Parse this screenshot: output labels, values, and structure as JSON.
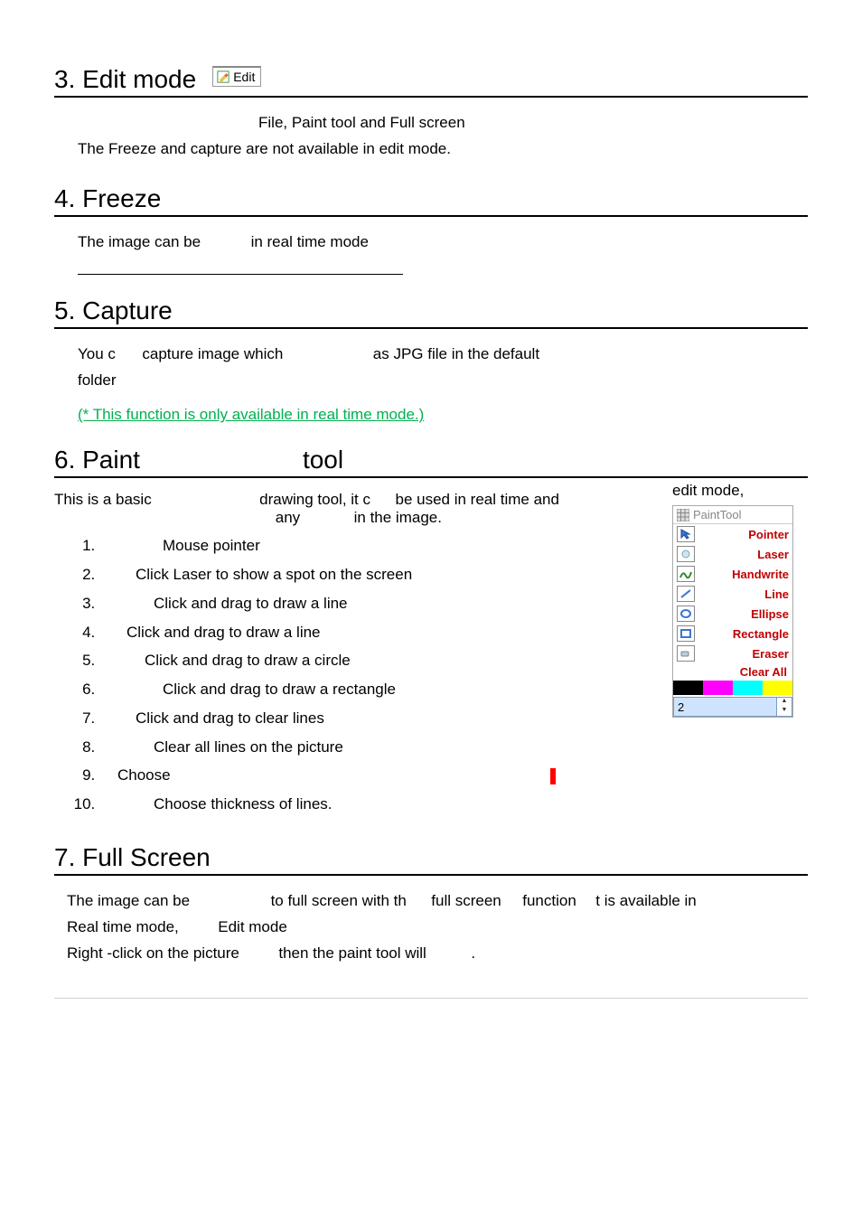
{
  "s3": {
    "heading": "3. Edit mode",
    "badge": "Edit",
    "line1": "File, Paint tool and Full screen",
    "line2": "The Freeze and capture are not available in edit mode."
  },
  "s4": {
    "heading": "4. Freeze",
    "line1a": "The image can be",
    "line1b": "in real time mode"
  },
  "s5": {
    "heading": "5. Capture",
    "l1a": "You c",
    "l1b": "capture image   which",
    "l1c": "as JPG file   in the default",
    "l2": "folder",
    "note": "(* This function is only available in real time mode.)"
  },
  "s6": {
    "heading_a": "6. Paint",
    "heading_b": "tool",
    "intro1a": "This is a basic",
    "intro1b": "drawing tool, it c",
    "intro1c": "be used in real time and",
    "intro2a": "any",
    "intro2b": "in the image.",
    "right_label": "edit mode,",
    "items": [
      "Mouse pointer",
      "Click  Laser  to show a spot on the screen",
      "Click and drag to draw a line",
      "Click and drag to draw a line",
      "Click and drag to draw a circle",
      "Click and drag to draw a rectangle",
      "Click and drag to clear lines",
      "Clear all lines on the picture",
      "Choose",
      "Choose thickness of lines."
    ],
    "item_indent": [
      70,
      40,
      60,
      30,
      50,
      70,
      40,
      60,
      20,
      60
    ]
  },
  "paint_tool": {
    "title": "PaintTool",
    "rows": [
      "Pointer",
      "Laser",
      "Handwrite",
      "Line",
      "Ellipse",
      "Rectangle",
      "Eraser",
      "Clear All"
    ],
    "thickness": "2",
    "swatches": [
      "#000000",
      "#ff00ff",
      "#00ffff",
      "#ffff00"
    ]
  },
  "s7": {
    "heading": "7. Full Screen",
    "l1a": "The image can be",
    "l1b": "to full screen with th",
    "l1c": "full screen",
    "l1d": "function",
    "l1e": "t is available in",
    "l2a": "Real time mode,",
    "l2b": "Edit mode",
    "l3a": "Right -click on the picture",
    "l3b": "then the paint tool will",
    "l3c": "."
  }
}
